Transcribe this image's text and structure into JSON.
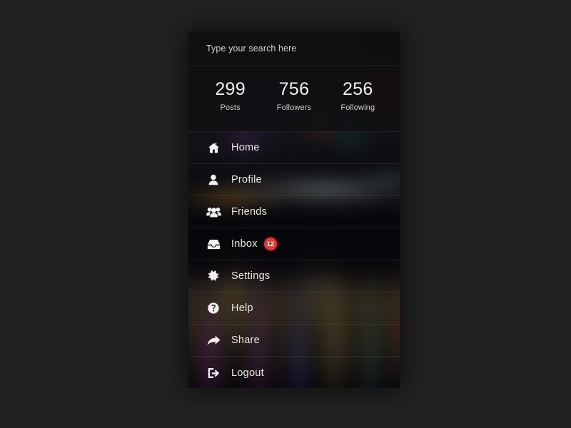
{
  "theme": {
    "page_background": "#222222",
    "panel_background": "#0a0a0c",
    "text_primary": "#ebe7e2",
    "text_secondary": "#cfcfcf",
    "icon_color": "#f2f2f2",
    "badge_background": "#e8382c",
    "badge_text": "#ffffff",
    "divider": "rgba(255,255,255,0.075)"
  },
  "search": {
    "placeholder": "Type your search here",
    "value": ""
  },
  "stats": [
    {
      "value": "299",
      "label": "Posts"
    },
    {
      "value": "756",
      "label": "Followers"
    },
    {
      "value": "256",
      "label": "Following"
    }
  ],
  "menu": [
    {
      "label": "Home",
      "icon": "home-icon"
    },
    {
      "label": "Profile",
      "icon": "user-icon"
    },
    {
      "label": "Friends",
      "icon": "friends-icon"
    },
    {
      "label": "Inbox",
      "icon": "inbox-icon",
      "badge": "12"
    },
    {
      "label": "Settings",
      "icon": "gear-icon"
    },
    {
      "label": "Help",
      "icon": "help-circle-icon"
    },
    {
      "label": "Share",
      "icon": "share-arrow-icon"
    },
    {
      "label": "Logout",
      "icon": "logout-icon"
    }
  ]
}
